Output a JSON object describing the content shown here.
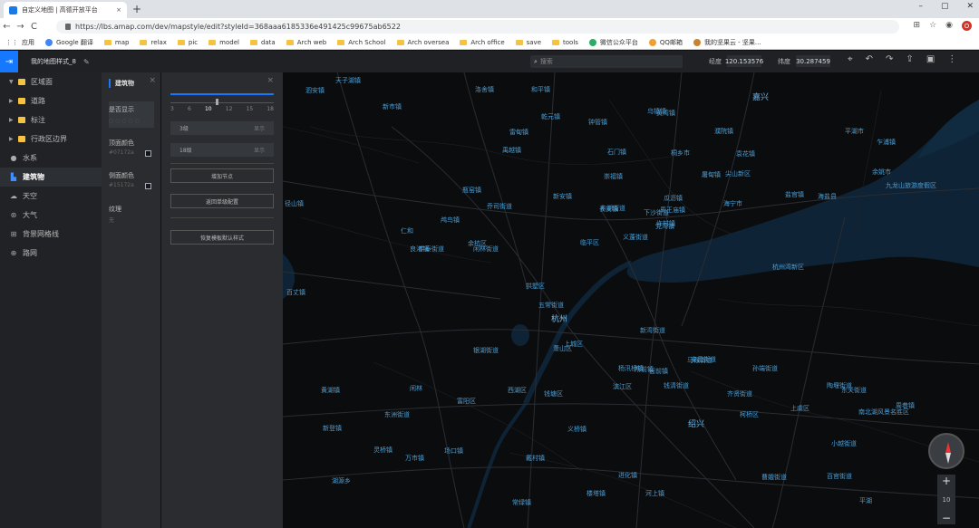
{
  "browser": {
    "tab_title": "自定义地图 | 高德开放平台",
    "tab_close": "×",
    "new_tab": "+",
    "window_controls": [
      "–",
      "▢",
      "✕"
    ],
    "url": "https://lbs.amap.com/dev/mapstyle/edit?styleId=368aaa6185336e491425c99675ab6522",
    "bookmarks": [
      "应用",
      "Google 翻译",
      "map",
      "relax",
      "pic",
      "model",
      "data",
      "Arch web",
      "Arch School",
      "Arch oversea",
      "Arch office",
      "save",
      "tools",
      "微信公众平台",
      "QQ邮箱",
      "我的坚果云 - 坚果..."
    ]
  },
  "header": {
    "map_name": "我的地图样式_8",
    "search_placeholder": "搜索",
    "lng_label": "经度",
    "lng_value": "120.153576",
    "lat_label": "纬度",
    "lat_value": "30.287459"
  },
  "layers": [
    {
      "label": "区域面",
      "kind": "folder"
    },
    {
      "label": "道路",
      "kind": "folder"
    },
    {
      "label": "标注",
      "kind": "folder"
    },
    {
      "label": "行政区边界",
      "kind": "folder"
    },
    {
      "label": "水系",
      "kind": "item",
      "icon": "water-icon"
    },
    {
      "label": "建筑物",
      "kind": "item",
      "icon": "building-icon",
      "active": true
    },
    {
      "label": "天空",
      "kind": "item",
      "icon": "cloud-icon"
    },
    {
      "label": "大气",
      "kind": "item",
      "icon": "atmosphere-icon"
    },
    {
      "label": "背景网格线",
      "kind": "item",
      "icon": "grid-icon"
    },
    {
      "label": "路网",
      "kind": "item",
      "icon": "road-icon"
    }
  ],
  "style_panel": {
    "title": "建筑物",
    "visibility_label": "是否显示",
    "top_color_label": "顶面颜色",
    "top_color_value": "#07172a",
    "side_color_label": "侧面颜色",
    "side_color_value": "#15172a",
    "texture_label": "纹理",
    "texture_value": "无"
  },
  "zoom_panel": {
    "ticks": [
      "3",
      "6",
      "10",
      "12",
      "15",
      "18"
    ],
    "active_tick": "10",
    "rows": [
      {
        "level": "3级",
        "state": "显示"
      },
      {
        "level": "18级",
        "state": "显示"
      }
    ],
    "add_node": "增加节点",
    "back": "返回单级配置",
    "reset": "恢复模板默认样式"
  },
  "map": {
    "zoom_level": "10",
    "zoom_in": "+",
    "zoom_out": "−",
    "city_labels": [
      "嘉兴",
      "杭州",
      "绍兴"
    ],
    "place_labels": [
      "天子湖镇",
      "泗安镇",
      "和平镇",
      "洛舍镇",
      "新市镇",
      "雷甸镇",
      "乾元镇",
      "钟管镇",
      "禹越镇",
      "新安镇",
      "崇福镇",
      "桐乡市",
      "乌镇镇",
      "濮院镇",
      "石门镇",
      "屠甸镇",
      "海宁市",
      "长安镇",
      "许村镇",
      "盐官镇",
      "袁花镇",
      "周王庙镇",
      "海盐县",
      "平湖市",
      "乍浦镇",
      "黄湾镇",
      "尖山新区",
      "瓶窑镇",
      "仁和",
      "良渚镇",
      "余杭区",
      "临平区",
      "东湖街道",
      "乔司街道",
      "下沙街道",
      "义蓬街道",
      "瓜沥镇",
      "党湾镇",
      "萧山区",
      "新湾街道",
      "钱塘区",
      "滨江区",
      "西湖区",
      "上城区",
      "拱墅区",
      "富阳区",
      "闲林街道",
      "五常街道",
      "中泰街道",
      "径山镇",
      "百丈镇",
      "黄湖镇",
      "鸬鸟镇",
      "闲林",
      "银湖街道",
      "东洲街道",
      "灵桥镇",
      "新登镇",
      "场口镇",
      "万市镇",
      "湖源乡",
      "常绿镇",
      "戴村镇",
      "楼塔镇",
      "河上镇",
      "进化镇",
      "义桥镇",
      "所前镇",
      "衙前镇",
      "杨汛桥镇",
      "钱清街道",
      "安昌街道",
      "齐贤街道",
      "柯桥区",
      "马鞍街道",
      "孙端街道",
      "陶堰街道",
      "上虞区",
      "东关街道",
      "曹娥街道",
      "小越街道",
      "百官街道",
      "平湖",
      "南北湖风景名胜区",
      "杭州湾新区",
      "九龙山旅游度假区",
      "余姚市",
      "周巷镇"
    ]
  }
}
